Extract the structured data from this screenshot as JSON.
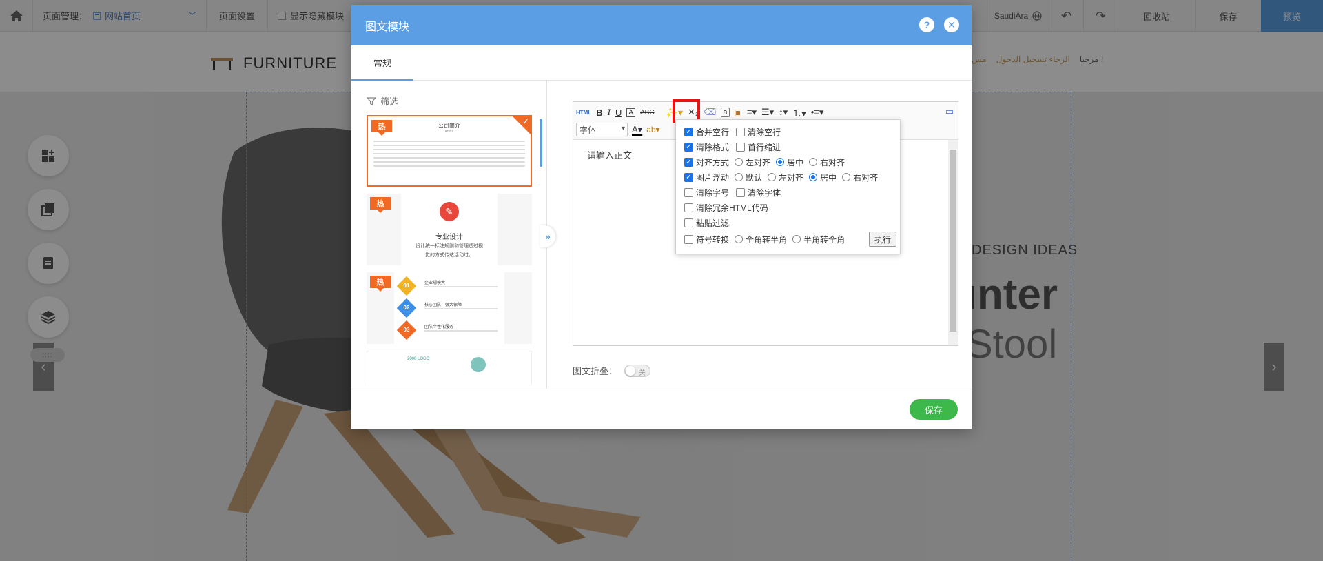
{
  "topbar": {
    "page_manage_label": "页面管理：",
    "current_page": "网站首页",
    "page_settings": "页面设置",
    "show_hidden_modules": "显示隐藏模块",
    "language": "SaudiAra",
    "recycle": "回收站",
    "save": "保存",
    "preview": "预览"
  },
  "site": {
    "logo_text": "FURNITURE",
    "header_links": [
      "مرحبا !",
      "الرجاء تسجيل الدخول",
      "مس"
    ],
    "hero_subtitle": "DESIGN IDEAS",
    "hero_title": "unter",
    "hero_title2": "Stool"
  },
  "modal": {
    "title": "图文模块",
    "tab_general": "常规",
    "filter_label": "筛选",
    "hot_badge": "热",
    "template1": {
      "title": "公司简介",
      "sub": "About"
    },
    "template2": {
      "title": "专业设计",
      "line1": "设计统一标注规则和管理透过视",
      "line2": "觉的方式传达活动过。"
    },
    "template3": {
      "items": [
        {
          "num": "01",
          "title": "企业规模大"
        },
        {
          "num": "02",
          "title": "核心团队，强大保障"
        },
        {
          "num": "03",
          "title": "团队个性化服务"
        }
      ]
    },
    "template4": {
      "label": "2000 LOGO"
    },
    "editor": {
      "html_label": "HTML",
      "font_placeholder": "字体",
      "body_placeholder": "请输入正文"
    },
    "filter_popup": {
      "merge_blank_lines": "合并空行",
      "clear_blank_lines": "清除空行",
      "clear_format": "清除格式",
      "first_line_indent": "首行缩进",
      "alignment": "对齐方式",
      "align_left": "左对齐",
      "align_center": "居中",
      "align_right": "右对齐",
      "image_float": "图片浮动",
      "float_default": "默认",
      "float_left": "左对齐",
      "float_center": "居中",
      "float_right": "右对齐",
      "clear_font_size": "清除字号",
      "clear_font_family": "清除字体",
      "clear_redundant_html": "清除冗余HTML代码",
      "paste_filter": "粘贴过滤",
      "symbol_convert": "符号转换",
      "full_to_half": "全角转半角",
      "half_to_full": "半角转全角",
      "execute": "执行"
    },
    "collapse_label": "图文折叠：",
    "toggle_off": "关",
    "save_button": "保存"
  }
}
